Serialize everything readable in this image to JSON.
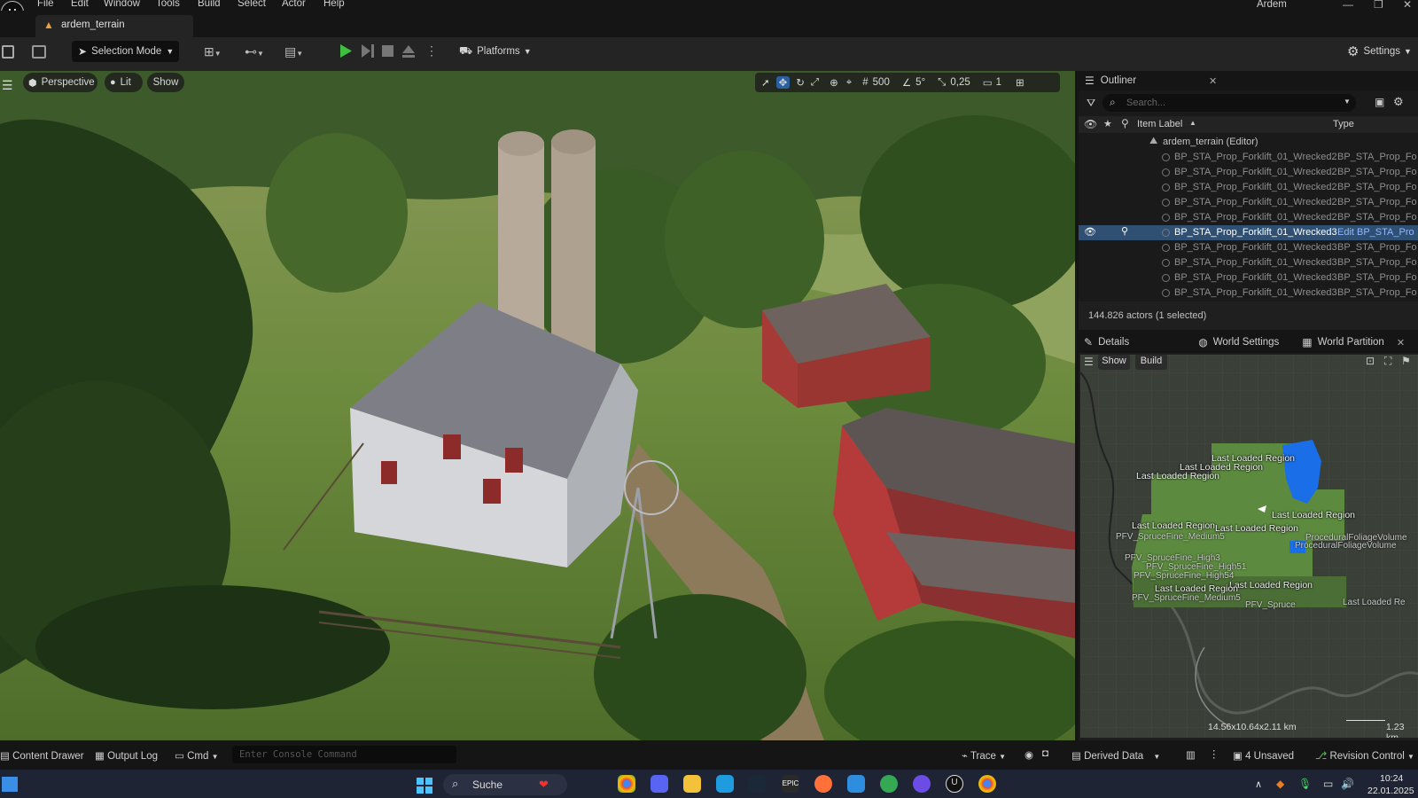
{
  "app": {
    "project_name": "Ardem"
  },
  "menu": [
    "File",
    "Edit",
    "Window",
    "Tools",
    "Build",
    "Select",
    "Actor",
    "Help"
  ],
  "document_tab": {
    "label": "ardem_terrain"
  },
  "toolbar": {
    "selection_mode": "Selection Mode",
    "platforms": "Platforms",
    "settings": "Settings"
  },
  "viewport": {
    "view_mode": "Perspective",
    "lighting": "Lit",
    "show": "Show",
    "grid_snap": "500",
    "rotation_snap": "5°",
    "scale_snap": "0,25",
    "camera_speed": "1"
  },
  "outliner": {
    "title": "Outliner",
    "search_placeholder": "Search...",
    "col_label": "Item Label",
    "col_type": "Type",
    "root_label": "ardem_terrain (Editor)",
    "rows": [
      {
        "label": "BP_STA_Prop_Forklift_01_Wrecked2",
        "type": "BP_STA_Prop_Fo"
      },
      {
        "label": "BP_STA_Prop_Forklift_01_Wrecked2",
        "type": "BP_STA_Prop_Fo"
      },
      {
        "label": "BP_STA_Prop_Forklift_01_Wrecked2",
        "type": "BP_STA_Prop_Fo"
      },
      {
        "label": "BP_STA_Prop_Forklift_01_Wrecked2",
        "type": "BP_STA_Prop_Fo"
      },
      {
        "label": "BP_STA_Prop_Forklift_01_Wrecked2",
        "type": "BP_STA_Prop_Fo"
      },
      {
        "label": "BP_STA_Prop_Forklift_01_Wrecked3",
        "type": "Edit BP_STA_Pro",
        "selected": true
      },
      {
        "label": "BP_STA_Prop_Forklift_01_Wrecked3",
        "type": "BP_STA_Prop_Fo"
      },
      {
        "label": "BP_STA_Prop_Forklift_01_Wrecked3",
        "type": "BP_STA_Prop_Fo"
      },
      {
        "label": "BP_STA_Prop_Forklift_01_Wrecked3",
        "type": "BP_STA_Prop_Fo"
      },
      {
        "label": "BP_STA_Prop_Forklift_01_Wrecked3",
        "type": "BP_STA_Prop_Fo"
      }
    ],
    "actor_count": "144.826 actors (1 selected)"
  },
  "lower_tabs": {
    "details": "Details",
    "world_settings": "World Settings",
    "world_partition": "World Partition"
  },
  "world_partition": {
    "show": "Show",
    "build": "Build",
    "region_label": "Last Loaded Region",
    "labels": [
      "Last Loaded Region",
      "Last Loaded Region",
      "Last Loaded Region",
      "Last Loaded Region",
      "Last Loaded Region",
      "Last Loaded Region",
      "Last Loaded Region",
      "Last Loaded Region"
    ],
    "foliage_labels": [
      "PFV_SpruceFine_Medium5",
      "PFV_SpruceFine_High3",
      "PFV_SpruceFine_High51",
      "PFV_SpruceFine_High54",
      "PFV_SpruceFine_Medium5",
      "PFV_Spruce",
      "ProceduralFoliageVolume",
      "ProceduralFoliageVolume",
      "Last Loaded Re"
    ],
    "dimensions": "14.56x10.64x2.11 km",
    "scale": "1.23 km"
  },
  "statusbar": {
    "content_drawer": "Content Drawer",
    "output_log": "Output Log",
    "cmd": "Cmd",
    "console_placeholder": "Enter Console Command",
    "trace": "Trace",
    "derived_data": "Derived Data",
    "unsaved": "4 Unsaved",
    "revision_control": "Revision Control"
  },
  "taskbar": {
    "search": "Suche",
    "time": "10:24",
    "date": "22.01.2025"
  },
  "colors": {
    "accent_selected": "#2f4f73",
    "play_green": "#3fbf3f",
    "minimap_green": "#4f7d3a",
    "loaded_blue": "#1a6fe8"
  }
}
